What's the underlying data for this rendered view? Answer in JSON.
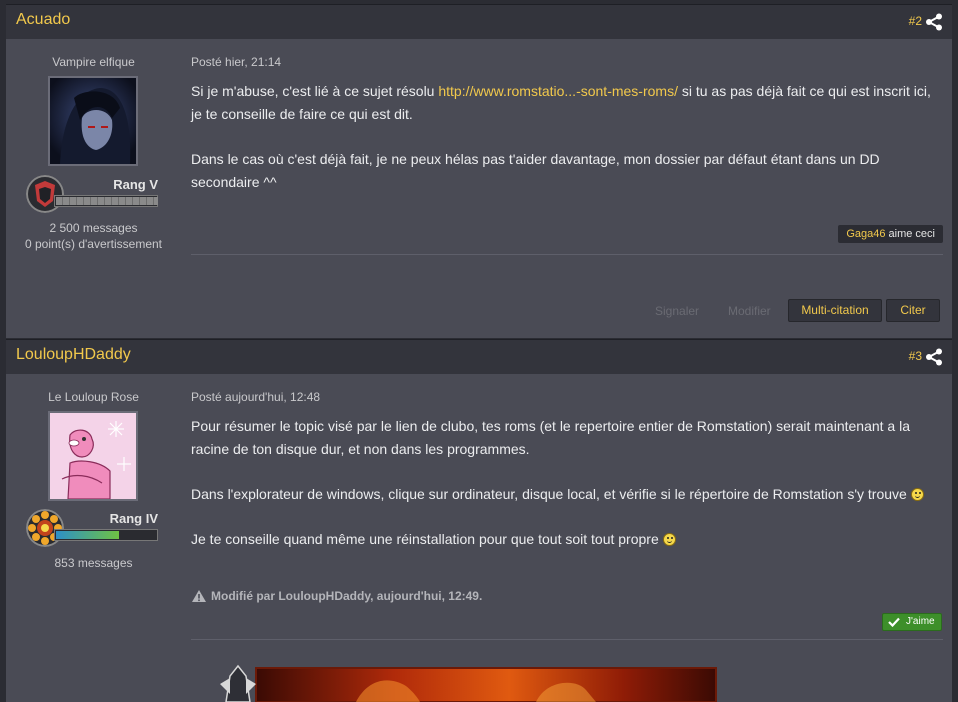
{
  "posts": [
    {
      "author": "Acuado",
      "number": "#2",
      "user_title": "Vampire elfique",
      "rank": "Rang V",
      "rank_progress": 1.0,
      "stats": [
        "2 500 messages",
        "0 point(s) d'avertissement"
      ],
      "date": "Posté hier, 21:14",
      "body": {
        "line1_before": "Si je m'abuse, c'est lié à ce sujet résolu ",
        "link": "http://www.romstatio...-sont-mes-roms/",
        "line1_after": " si tu as pas déjà fait ce qui est inscrit ici, je te conseille de faire ce qui est dit.",
        "paragraph2": "Dans le cas où c'est déjà fait, je ne peux hélas pas t'aider davantage, mon dossier par défaut étant dans un DD secondaire ^^"
      },
      "likes": {
        "who": "Gaga46",
        "text": " aime ceci"
      },
      "actions": {
        "report": "Signaler",
        "edit": "Modifier",
        "multiquote": "Multi-citation",
        "quote": "Citer"
      }
    },
    {
      "author": "LouloupHDaddy",
      "number": "#3",
      "user_title": "Le Louloup Rose",
      "rank": "Rang IV",
      "rank_progress": 0.62,
      "stats": [
        "853 messages"
      ],
      "date": "Posté aujourd'hui, 12:48",
      "body": {
        "paragraph1": "Pour résumer le topic visé par le lien de clubo, tes roms (et le repertoire entier de Romstation) serait maintenant a la racine de ton disque dur, et non dans les programmes.",
        "paragraph2": "Dans l'explorateur de windows, clique sur ordinateur, disque local, et vérifie si le répertoire de Romstation s'y trouve ",
        "paragraph3": "Je te conseille quand même une réinstallation pour que tout soit tout propre "
      },
      "edit_note": "Modifié par LouloupHDaddy, aujourd'hui, 12:49.",
      "like_button": "J'aime"
    }
  ],
  "colors": {
    "accent": "#f2c94c",
    "header_bg": "#33343c",
    "post_bg": "#4a4b55",
    "like_green": "#3d8f2a"
  },
  "icons": [
    "share-icon",
    "warning-icon",
    "check-icon",
    "smiley-icon"
  ]
}
